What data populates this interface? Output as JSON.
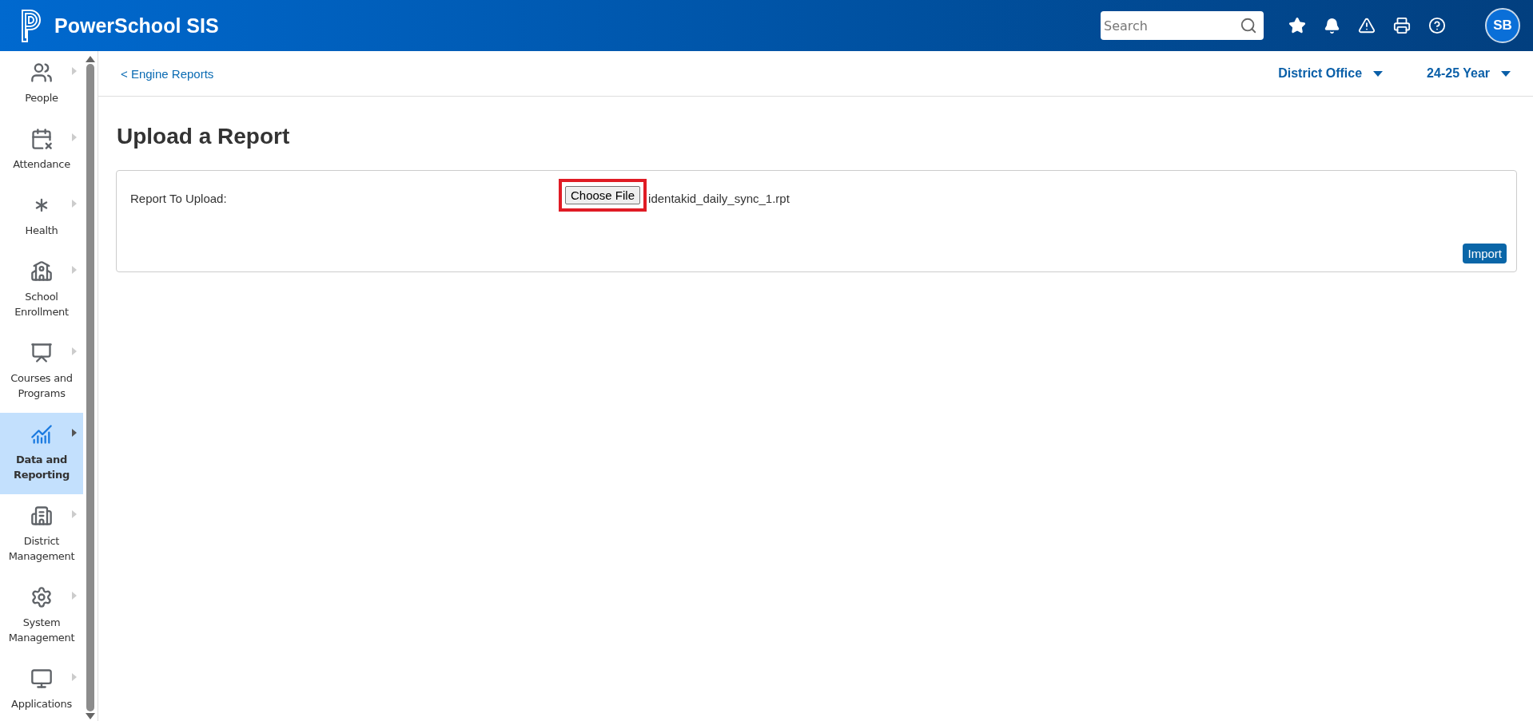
{
  "header": {
    "product": "PowerSchool SIS",
    "search": {
      "placeholder": "Search"
    },
    "avatar": "SB"
  },
  "sidebar": {
    "items": [
      {
        "label": "People",
        "selected": false
      },
      {
        "label": "Attendance",
        "selected": false
      },
      {
        "label": "Health",
        "selected": false
      },
      {
        "label": "School Enrollment",
        "selected": false
      },
      {
        "label": "Courses and Programs",
        "selected": false
      },
      {
        "label": "Data and Reporting",
        "selected": true
      },
      {
        "label": "District Management",
        "selected": false
      },
      {
        "label": "System Management",
        "selected": false
      },
      {
        "label": "Applications",
        "selected": false
      }
    ]
  },
  "breadcrumb": "< Engine Reports",
  "context": {
    "school": "District Office",
    "term": "24-25 Year"
  },
  "page_title": "Upload a Report",
  "form": {
    "label": "Report To Upload:",
    "file_button": "Choose File",
    "file_name": "identakid_daily_sync_1.rpt",
    "highlighted": true,
    "submit": "Import"
  }
}
